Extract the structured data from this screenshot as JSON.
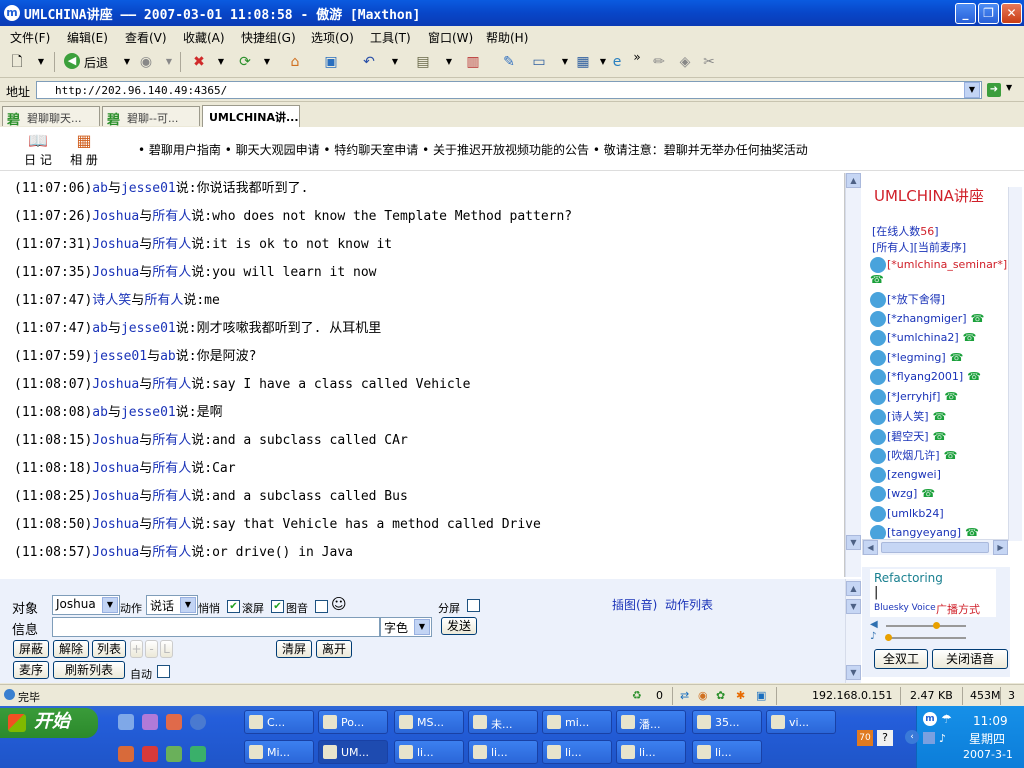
{
  "window": {
    "title": "UMLCHINA讲座 —— 2007-03-01 11:08:58 - 傲游 [Maxthon]",
    "app_icon": "m"
  },
  "menu": [
    "文件(F)",
    "编辑(E)",
    "查看(V)",
    "收藏(A)",
    "快捷组(G)",
    "选项(O)",
    "工具(T)",
    "窗口(W)",
    "帮助(H)"
  ],
  "toolbar": {
    "back_label": "后退"
  },
  "address": {
    "label": "地址",
    "url": "http://202.96.140.49:4365/"
  },
  "tabs": [
    {
      "label": "碧聊聊天...",
      "icon": "碧"
    },
    {
      "label": "碧聊--可...",
      "icon": "碧"
    },
    {
      "label": "UMLCHINA讲...",
      "active": true
    }
  ],
  "topnav": {
    "diary": "日 记",
    "album": "相 册",
    "announcement": "• 碧聊用户指南 • 聊天大观园申请 • 特约聊天室申请 • 关于推迟开放视频功能的公告 • 敬请注意：碧聊并无举办任何抽奖活动"
  },
  "messages": [
    {
      "time": "(11:07:06)",
      "from": "ab",
      "to": "jesse01",
      "text": "你说话我都听到了."
    },
    {
      "time": "(11:07:26)",
      "from": "Joshua",
      "to": "所有人",
      "text": "who does not know the Template Method pattern?"
    },
    {
      "time": "(11:07:31)",
      "from": "Joshua",
      "to": "所有人",
      "text": "it is ok to not know it"
    },
    {
      "time": "(11:07:35)",
      "from": "Joshua",
      "to": "所有人",
      "text": "you will learn it now"
    },
    {
      "time": "(11:07:47)",
      "from": "诗人笑",
      "to": "所有人",
      "text": "me"
    },
    {
      "time": "(11:07:47)",
      "from": "ab",
      "to": "jesse01",
      "text": "刚才咳嗽我都听到了. 从耳机里"
    },
    {
      "time": "(11:07:59)",
      "from": "jesse01",
      "to": "ab",
      "text": "你是阿波?"
    },
    {
      "time": "(11:08:07)",
      "from": "Joshua",
      "to": "所有人",
      "text": "say I have a class called Vehicle"
    },
    {
      "time": "(11:08:08)",
      "from": "ab",
      "to": "jesse01",
      "text": "是啊"
    },
    {
      "time": "(11:08:15)",
      "from": "Joshua",
      "to": "所有人",
      "text": "and a subclass called CAr"
    },
    {
      "time": "(11:08:18)",
      "from": "Joshua",
      "to": "所有人",
      "text": "Car"
    },
    {
      "time": "(11:08:25)",
      "from": "Joshua",
      "to": "所有人",
      "text": "and a subclass called Bus"
    },
    {
      "time": "(11:08:50)",
      "from": "Joshua",
      "to": "所有人",
      "text": "say that Vehicle has a method called Drive"
    },
    {
      "time": "(11:08:57)",
      "from": "Joshua",
      "to": "所有人",
      "text": "or drive() in Java"
    }
  ],
  "msg_words": {
    "and": "与",
    "said": "说:"
  },
  "room": {
    "title": "UMLCHINA讲座",
    "online_prefix": "[在线人数",
    "online_count": "56",
    "online_suffix": "]",
    "tabs": "[所有人][当前麦序]",
    "users": [
      "[*umlchina_seminar*]",
      "[*放下舍得]",
      "[*zhangmiger]",
      "[*umlchina2]",
      "[*legming]",
      "[*flyang2001]",
      "[*Jerryhjf]",
      "[诗人笑]",
      "[碧空天]",
      "[吹烟几许]",
      "[zengwei]",
      "[wzg]",
      "[umlkb24]",
      "[tangyeyang]"
    ]
  },
  "input": {
    "target_label": "对象",
    "target_value": "Joshua",
    "action_label": "动作",
    "action_value": "说话",
    "whisper": "悄悄",
    "scroll": "滚屏",
    "image_sound": "图音",
    "split": "分屏",
    "insert_link": "插图(音)",
    "action_list": "动作列表",
    "message_label": "信息",
    "message_value": "",
    "font_color": "字色",
    "send": "发送",
    "block": "屏蔽",
    "unblock": "解除",
    "list": "列表",
    "plus": "+",
    "minus": "-",
    "l": "L",
    "clear": "清屏",
    "leave": "离开",
    "mic_order": "麦序",
    "refresh_list": "刷新列表",
    "auto": "自动"
  },
  "voice": {
    "refactoring": "Refactoring",
    "cursor": "|",
    "brand": "Bluesky Voice",
    "broadcast": "广播方式",
    "full_duplex": "全双工",
    "close_voice": "关闭语音"
  },
  "statusbar": {
    "status": "完毕",
    "count": "0",
    "ip": "192.168.0.151",
    "size": "2.47 KB",
    "mem": "453M",
    "tabs": "3"
  },
  "taskbar": {
    "start": "开始",
    "row1": [
      "C...",
      "Po...",
      "MS...",
      "未...",
      "mi...",
      "潘...",
      "35...",
      "vi..."
    ],
    "row2": [
      "Mi...",
      "UM...",
      "li...",
      "li...",
      "li...",
      "li...",
      "li..."
    ],
    "clock_time": "11:09",
    "clock_day": "星期四",
    "clock_date": "2007-3-1"
  },
  "colors": {
    "titlebar": "#0846c8",
    "username": "#1a33b8",
    "room_title": "#d0202a",
    "taskbar": "#245edb"
  }
}
